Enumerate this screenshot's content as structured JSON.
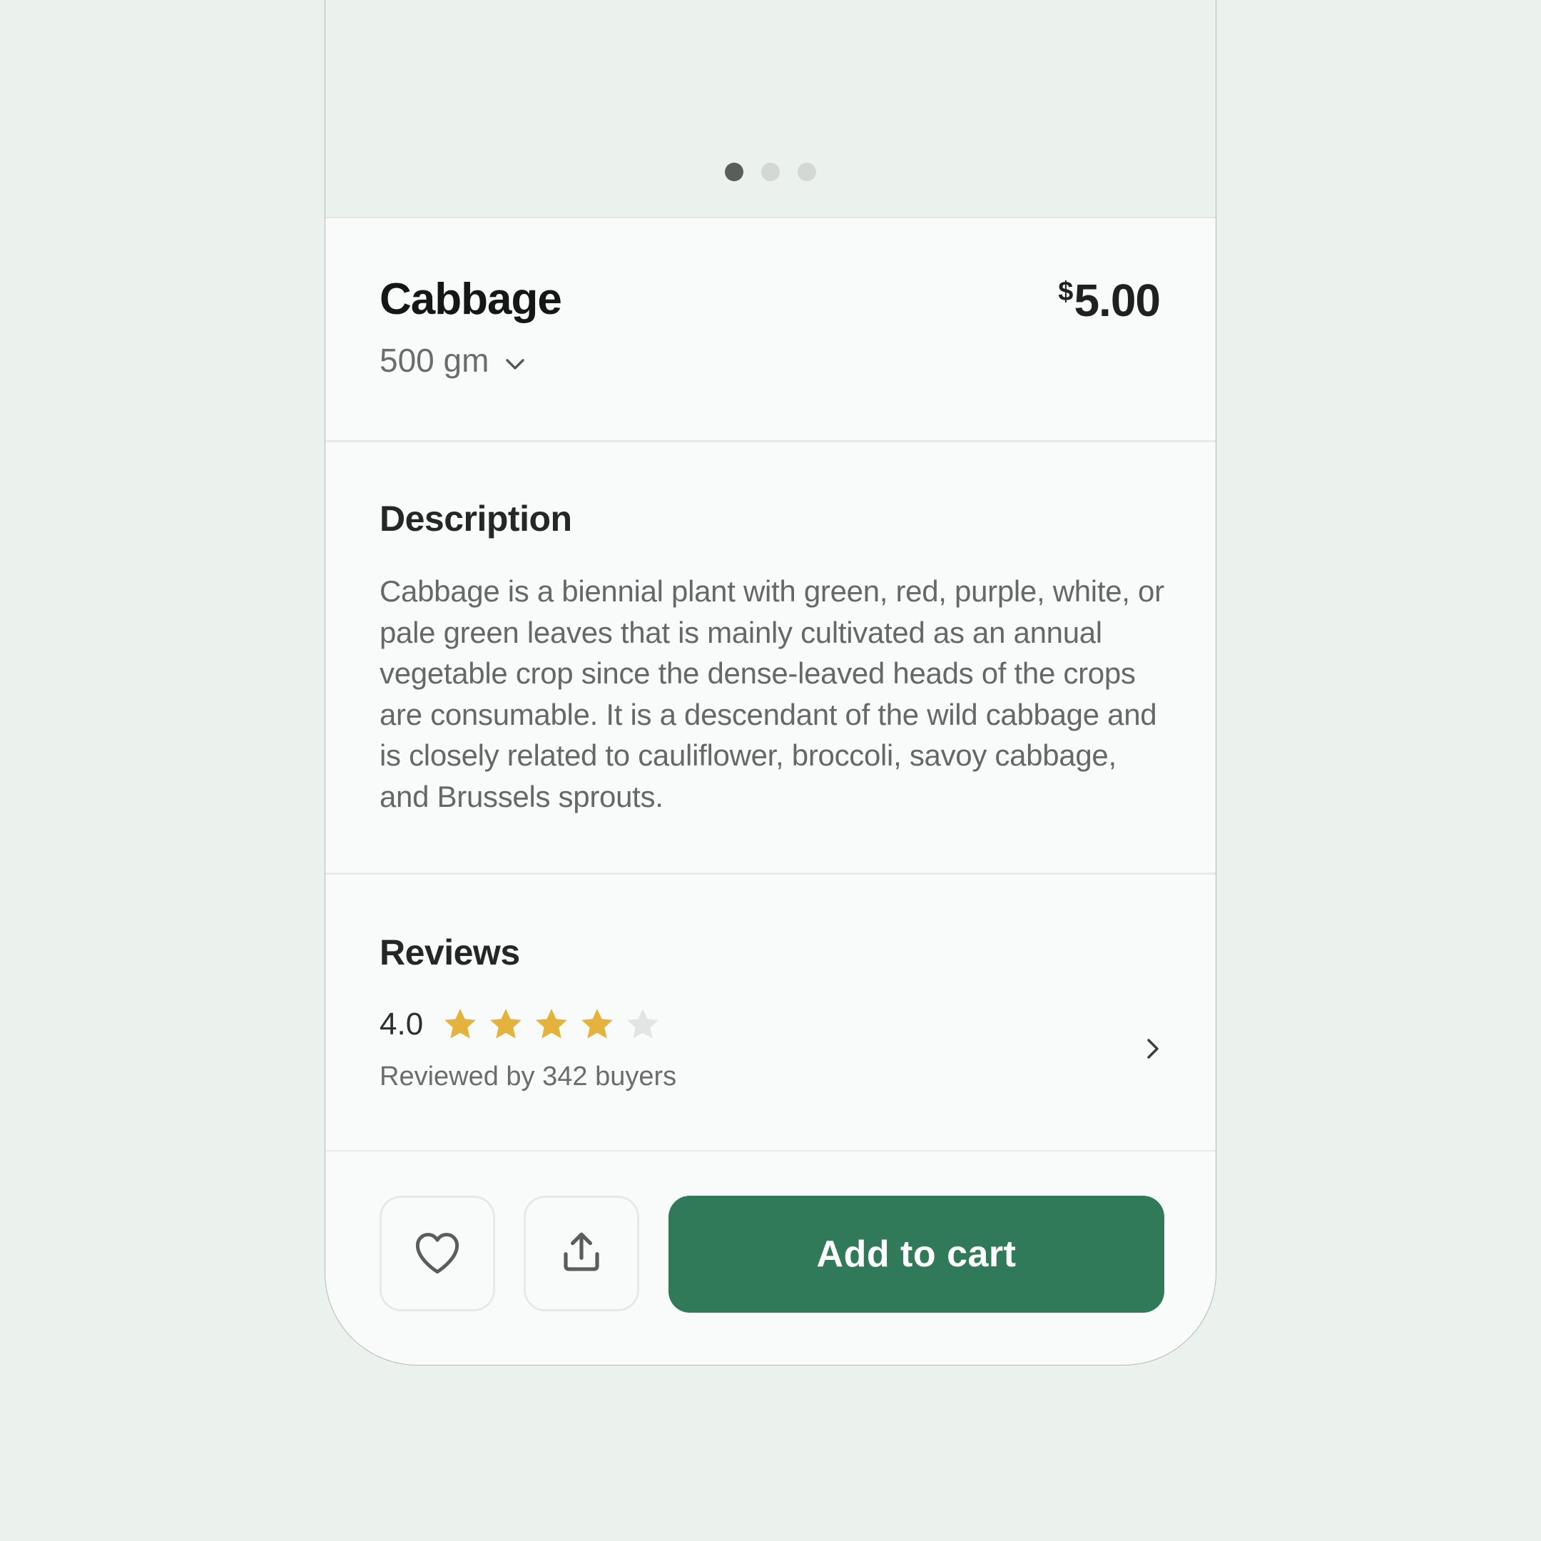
{
  "product": {
    "name": "Cabbage",
    "currency_symbol": "$",
    "price": "5.00",
    "weight": "500 gm"
  },
  "carousel": {
    "total_slides": 3,
    "active_slide": 1
  },
  "description": {
    "heading": "Description",
    "text": "Cabbage is a biennial plant with green, red, purple, white, or pale green leaves that is mainly cultivated as an annual vegetable crop since the dense-leaved heads of the crops are consumable. It is a descendant of the wild cabbage and is closely related to cauliflower, broccoli, savoy cabbage, and Brussels sprouts."
  },
  "reviews": {
    "heading": "Reviews",
    "rating": "4.0",
    "stars_filled": 4,
    "stars_total": 5,
    "reviewed_by": "Reviewed by 342 buyers"
  },
  "actions": {
    "favorite_icon": "heart-icon",
    "share_icon": "share-icon",
    "add_to_cart_label": "Add to cart"
  },
  "colors": {
    "background": "#EBF2ED",
    "accent": "#307A5A",
    "star_filled": "#E3B33E",
    "star_empty": "#E3E5E4"
  }
}
